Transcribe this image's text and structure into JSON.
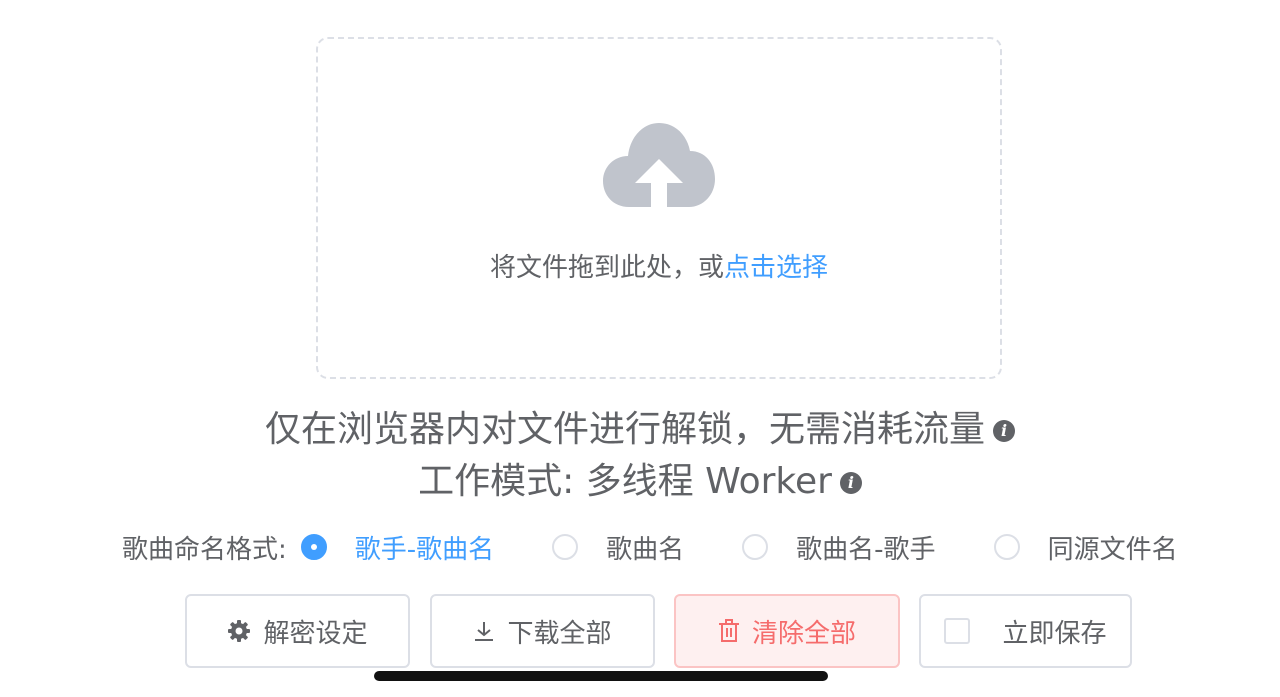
{
  "dropzone": {
    "icon": "cloud-upload-icon",
    "text": "将文件拖到此处，或",
    "link": "点击选择"
  },
  "info": {
    "line1": "仅在浏览器内对文件进行解锁，无需消耗流量",
    "line2": "工作模式: 多线程 Worker",
    "icon_glyph": "i"
  },
  "naming": {
    "label": "歌曲命名格式:",
    "options": [
      {
        "label": "歌手-歌曲名",
        "checked": true
      },
      {
        "label": "歌曲名",
        "checked": false
      },
      {
        "label": "歌曲名-歌手",
        "checked": false
      },
      {
        "label": "同源文件名",
        "checked": false
      }
    ]
  },
  "buttons": {
    "settings": "解密设定",
    "download_all": "下载全部",
    "clear_all": "清除全部",
    "save_now": "立即保存"
  },
  "colors": {
    "accent": "#409eff",
    "danger": "#f56c6c",
    "text": "#606266",
    "icon_gray": "#c0c4cc"
  }
}
